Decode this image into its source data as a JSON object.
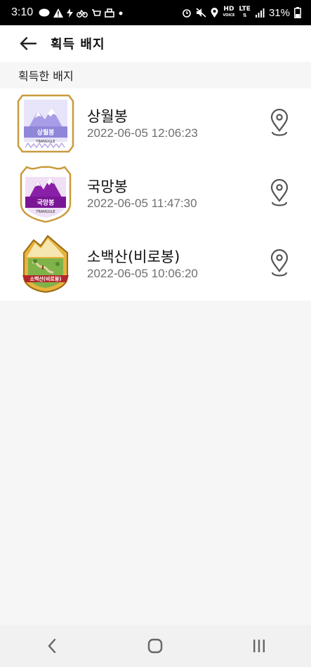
{
  "status_bar": {
    "time": "3:10",
    "battery_percent": "31%",
    "network_hd": "HD",
    "network_voice": "VOICE",
    "network_lte": "LTE"
  },
  "header": {
    "title": "획득 배지"
  },
  "section": {
    "label": "획득한 배지"
  },
  "badges": [
    {
      "name": "상월봉",
      "date": "2022-06-05 12:06:23",
      "badge_text": "상월봉",
      "brand": "TRANGGLE",
      "color": "#a79de6"
    },
    {
      "name": "국망봉",
      "date": "2022-06-05 11:47:30",
      "badge_text": "국망봉",
      "brand": "TRANGGLE",
      "color": "#8a1fa8"
    },
    {
      "name": "소백산(비로봉)",
      "date": "2022-06-05 10:06:20",
      "badge_text": "소백산(비로봉)",
      "color": "#b3262b"
    }
  ],
  "icons": {
    "back": "arrow-left-icon",
    "pin": "map-pin-icon",
    "nav_back": "chevron-left-icon",
    "nav_home": "rounded-square-icon",
    "nav_recents": "three-bars-icon"
  }
}
